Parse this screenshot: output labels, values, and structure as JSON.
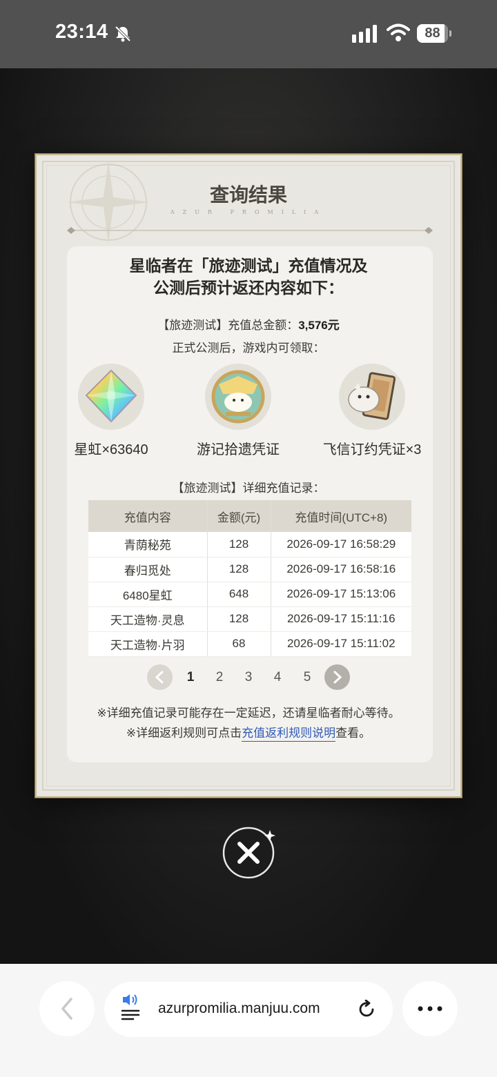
{
  "status_bar": {
    "time": "23:14",
    "battery": "88",
    "battery_level": 0.88
  },
  "dialog": {
    "title": "查询结果",
    "subtitle": "AZUR PROMILIA",
    "headline_line1": "星临者在「旅迹测试」充值情况及",
    "headline_line2": "公测后预计返还内容如下：",
    "total_label": "【旅迹测试】充值总金额：",
    "total_value": "3,576元",
    "claim_label": "正式公测后，游戏内可领取：",
    "rewards": [
      {
        "label": "星虹×63640",
        "icon": "prism-crystal-icon"
      },
      {
        "label": "游记拾遗凭证",
        "icon": "badge-emblem-icon"
      },
      {
        "label": "飞信订约凭证×3",
        "icon": "creature-card-icon"
      }
    ],
    "records_title": "【旅迹测试】详细充值记录：",
    "table": {
      "headers": [
        "充值内容",
        "金额(元)",
        "充值时间(UTC+8)"
      ],
      "rows": [
        [
          "青荫秘苑",
          "128",
          "2026-09-17 16:58:29"
        ],
        [
          "春归觅处",
          "128",
          "2026-09-17 16:58:16"
        ],
        [
          "6480星虹",
          "648",
          "2026-09-17 15:13:06"
        ],
        [
          "天工造物·灵息",
          "128",
          "2026-09-17 15:11:16"
        ],
        [
          "天工造物·片羽",
          "68",
          "2026-09-17 15:11:02"
        ]
      ]
    },
    "pagination": {
      "pages": [
        "1",
        "2",
        "3",
        "4",
        "5"
      ],
      "current": "1"
    },
    "note1": "※详细充值记录可能存在一定延迟，还请星临者耐心等待。",
    "note2_prefix": "※详细返利规则可点击",
    "note2_link": "充值返利规则说明",
    "note2_suffix": "查看。"
  },
  "browser": {
    "url": "azurpromilia.manjuu.com"
  }
}
